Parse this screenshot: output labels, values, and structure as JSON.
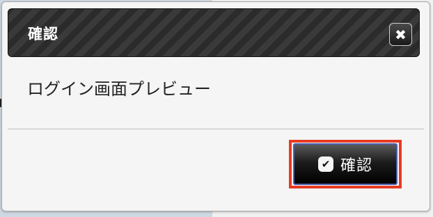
{
  "dialog": {
    "title": "確認",
    "close_glyph": "✖",
    "message": "ログイン画面プレビュー",
    "confirm_label": "確認",
    "check_glyph": "✔"
  },
  "icons": {
    "close": "close-icon",
    "confirm": "check-icon"
  },
  "colors": {
    "highlight": "#e63b23",
    "titlebar": "#2a2a2a",
    "button_border": "#4b5fb0"
  }
}
